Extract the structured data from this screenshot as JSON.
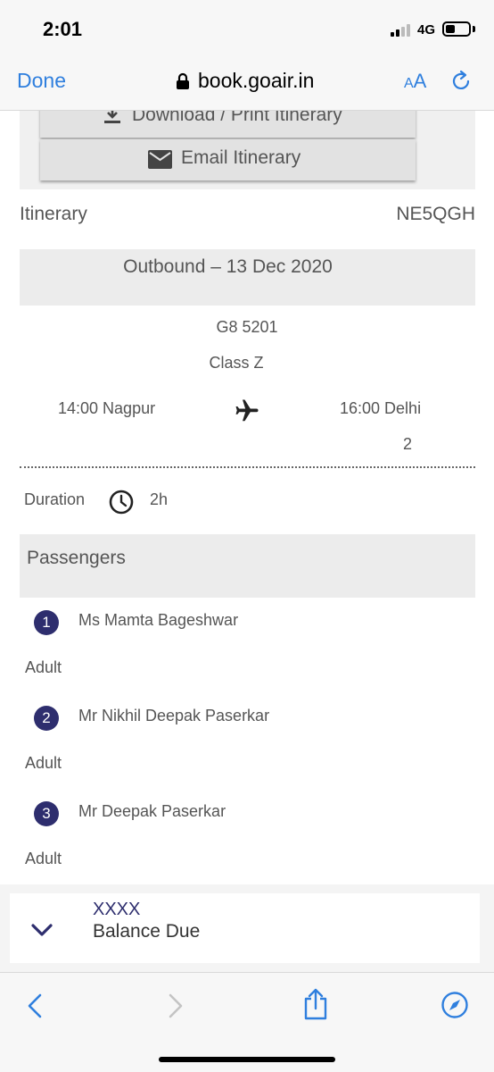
{
  "status_bar": {
    "time": "2:01",
    "network": "4G",
    "battery_level": 0.25
  },
  "browser": {
    "done_label": "Done",
    "url": "book.goair.in",
    "aa_small": "A",
    "aa_big": "A"
  },
  "actions": {
    "download_label": "Download / Print Itinerary",
    "email_label": "Email Itinerary"
  },
  "itinerary": {
    "label": "Itinerary",
    "pnr": "NE5QGH"
  },
  "outbound": {
    "header": "Outbound – 13 Dec 2020",
    "flight_number": "G8 5201",
    "class": "Class Z",
    "departure": "14:00 Nagpur",
    "arrival": "16:00 Delhi",
    "stops": "2",
    "duration_label": "Duration",
    "duration_value": "2h"
  },
  "passengers": {
    "title": "Passengers",
    "list": [
      {
        "num": "1",
        "name": "Ms Mamta Bageshwar",
        "type": "Adult"
      },
      {
        "num": "2",
        "name": "Mr Nikhil Deepak Paserkar",
        "type": "Adult"
      },
      {
        "num": "3",
        "name": "Mr Deepak Paserkar",
        "type": "Adult"
      }
    ]
  },
  "balance": {
    "amount": "XXXX",
    "label": "Balance Due"
  },
  "colors": {
    "accent": "#2f7fde",
    "brand": "#2e2e6e"
  }
}
